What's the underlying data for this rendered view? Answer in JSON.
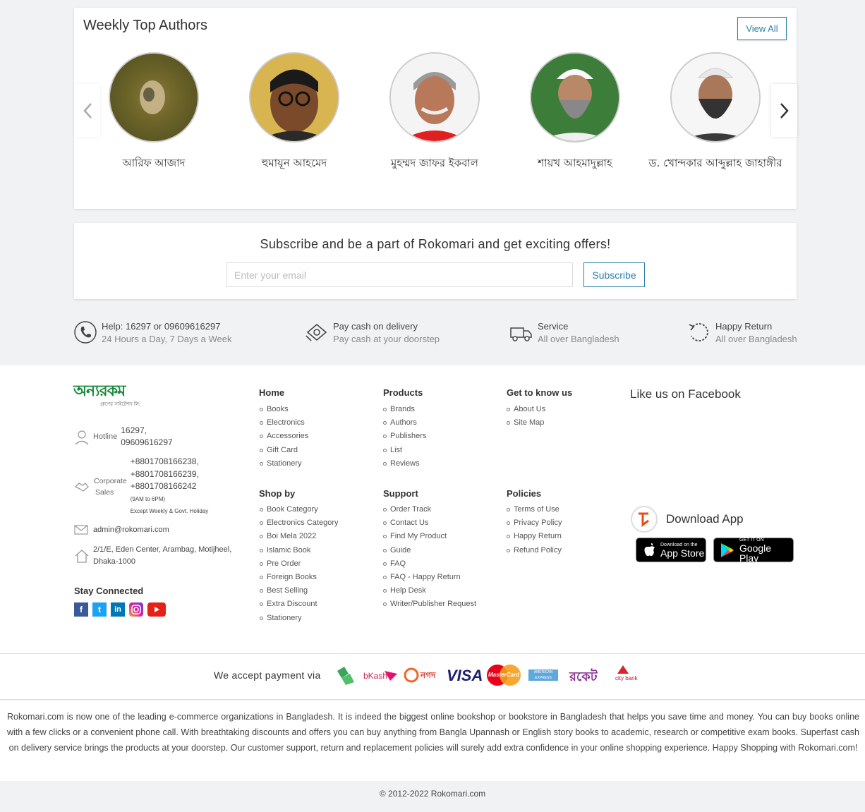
{
  "authors": {
    "title": "Weekly Top Authors",
    "view_all": "View All",
    "list": [
      {
        "name": "আরিফ আজাদ"
      },
      {
        "name": "হুমায়ূন আহমেদ"
      },
      {
        "name": "মুহম্মদ জাফর ইকবাল"
      },
      {
        "name": "শায়খ আহমাদুল্লাহ"
      },
      {
        "name": "ড. খোন্দকার আব্দুল্লাহ জাহাঙ্গীর"
      }
    ]
  },
  "subscribe": {
    "title": "Subscribe and be a part of Rokomari and get exciting offers!",
    "placeholder": "Enter your email",
    "button": "Subscribe"
  },
  "features": [
    {
      "title": "Help: 16297 or 09609616297",
      "sub": "24 Hours a Day, 7 Days a Week",
      "icon": "phone-icon"
    },
    {
      "title": "Pay cash on delivery",
      "sub": "Pay cash at your doorstep",
      "icon": "cash-icon"
    },
    {
      "title": "Service",
      "sub": "All over Bangladesh",
      "icon": "truck-icon"
    },
    {
      "title": "Happy Return",
      "sub": "All over Bangladesh",
      "icon": "return-icon"
    }
  ],
  "footer": {
    "logo_text": "অন্যরকম",
    "logo_sub": "গ্রুপের সাইটেশন লি:",
    "hotline_label": "Hotline",
    "hotline_1": "16297,",
    "hotline_2": "09609616297",
    "corporate_label_1": "Corporate",
    "corporate_label_2": "Sales",
    "corporate_1": "+8801708166238,",
    "corporate_2": "+8801708166239,",
    "corporate_3": "+8801708166242",
    "corporate_hours": "(9AM to 6PM)",
    "corporate_note": "Except Weekly & Govt. Holiday",
    "email": "admin@rokomari.com",
    "address_1": "2/1/E, Eden Center, Arambag, Motijheel,",
    "address_2": "Dhaka-1000",
    "stay_connected": "Stay Connected",
    "home_head": "Home",
    "home_links": [
      "Books",
      "Electronics",
      "Accessories",
      "Gift Card",
      "Stationery"
    ],
    "products_head": "Products",
    "products_links": [
      "Brands",
      "Authors",
      "Publishers",
      "List",
      "Reviews"
    ],
    "know_head": "Get to know us",
    "know_links": [
      "About Us",
      "Site Map"
    ],
    "shop_head": "Shop by",
    "shop_links": [
      "Book Category",
      "Electronics Category",
      "Boi Mela 2022",
      "Islamic Book",
      "Pre Order",
      "Foreign Books",
      "Best Selling",
      "Extra Discount",
      "Stationery"
    ],
    "support_head": "Support",
    "support_links": [
      "Order Track",
      "Contact Us",
      "Find My Product",
      "Guide",
      "FAQ",
      "FAQ - Happy Return",
      "Help Desk",
      "Writer/Publisher Request"
    ],
    "policies_head": "Policies",
    "policies_links": [
      "Terms of Use",
      "Privacy Policy",
      "Happy Return",
      "Refund Policy"
    ],
    "facebook": "Like us on Facebook",
    "download_app": "Download App",
    "appstore_small": "Download on the",
    "appstore_big": "App Store",
    "play_small": "GET IT ON",
    "play_big": "Google Play"
  },
  "payment": {
    "label": "We accept payment via",
    "methods": [
      "bKash",
      "নগদ",
      "VISA",
      "MasterCard",
      "AMERICAN EXPRESS",
      "রকেট",
      "city bank"
    ]
  },
  "about_text": "Rokomari.com is now one of the leading e-commerce organizations in Bangladesh. It is indeed the biggest online bookshop or bookstore in Bangladesh that helps you save time and money. You can buy books online with a few clicks or a convenient phone call. With breathtaking discounts and offers you can buy anything from Bangla Upannash or English story books to academic, research or competitive exam books. Superfast cash on delivery service brings the products at your doorstep. Our customer support, return and replacement policies will surely add extra confidence in your online shopping experience. Happy Shopping with Rokomari.com!",
  "copyright": "© 2012-2022 Rokomari.com",
  "colors": {
    "accent": "#2b7fa8",
    "logo_green": "#1a8a3c"
  }
}
